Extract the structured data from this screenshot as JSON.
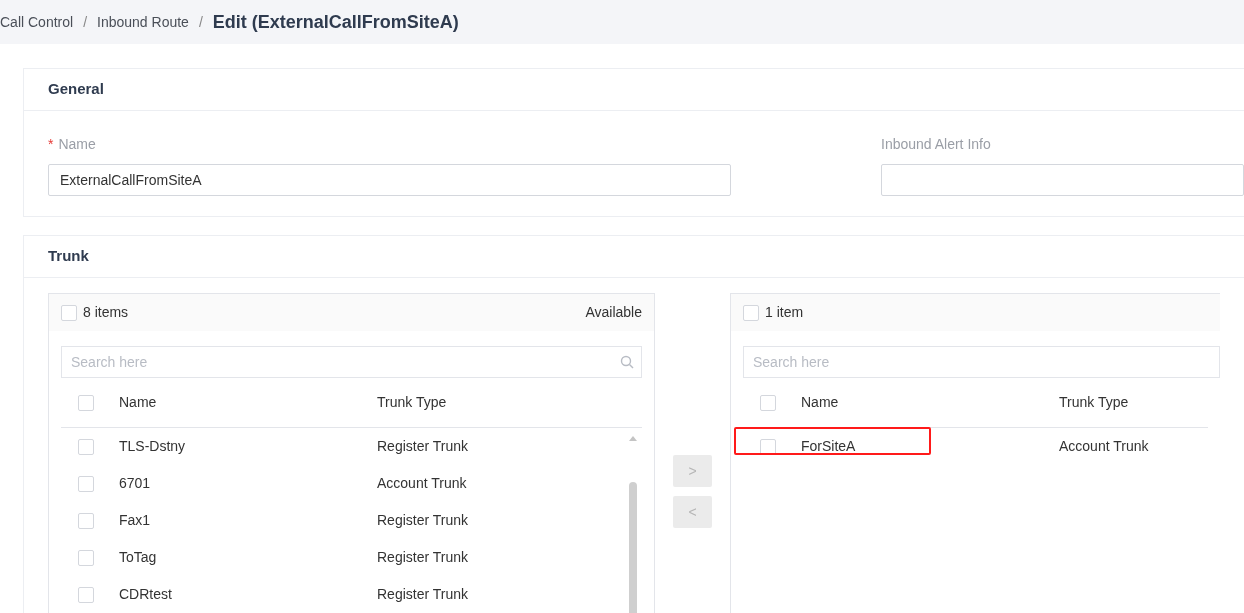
{
  "breadcrumb": [
    {
      "label": "Call Control",
      "current": false
    },
    {
      "separator": "/",
      "label": "Inbound Route",
      "current": false
    },
    {
      "separator": "/",
      "label": "Edit (ExternalCallFromSiteA)",
      "current": true
    }
  ],
  "general": {
    "title": "General",
    "fields": [
      {
        "label": "Name",
        "required_marker": "*",
        "value": "ExternalCallFromSiteA"
      },
      {
        "label": "Inbound Alert Info"
      }
    ]
  },
  "trunk": {
    "title": "Trunk",
    "available": {
      "count": "8 items",
      "caption": "Available",
      "checked": false,
      "header_checked": false,
      "search_placeholder": "Search here",
      "columns": [
        "Name",
        "Trunk Type"
      ],
      "rows": [
        {
          "name": "TLS-Dstny",
          "type": "Register Trunk",
          "checked": false,
          "highlighted": false
        },
        {
          "name": "6701",
          "type": "Account Trunk",
          "checked": false,
          "highlighted": false
        },
        {
          "name": "Fax1",
          "type": "Register Trunk",
          "checked": false,
          "highlighted": false
        },
        {
          "name": "ToTag",
          "type": "Register Trunk",
          "checked": false,
          "highlighted": false
        },
        {
          "name": "CDRtest",
          "type": "Register Trunk",
          "checked": false,
          "highlighted": false
        }
      ]
    },
    "move_buttons": [
      {
        "label": ">",
        "disabled": true
      },
      {
        "label": "<",
        "disabled": true
      }
    ],
    "selected": {
      "count": "1 item",
      "checked": false,
      "header_checked": false,
      "search_placeholder": "Search here",
      "columns": [
        "Name",
        "Trunk Type"
      ],
      "rows": [
        {
          "name": "ForSiteA",
          "type": "Account Trunk",
          "checked": false,
          "highlighted": true
        }
      ]
    }
  }
}
